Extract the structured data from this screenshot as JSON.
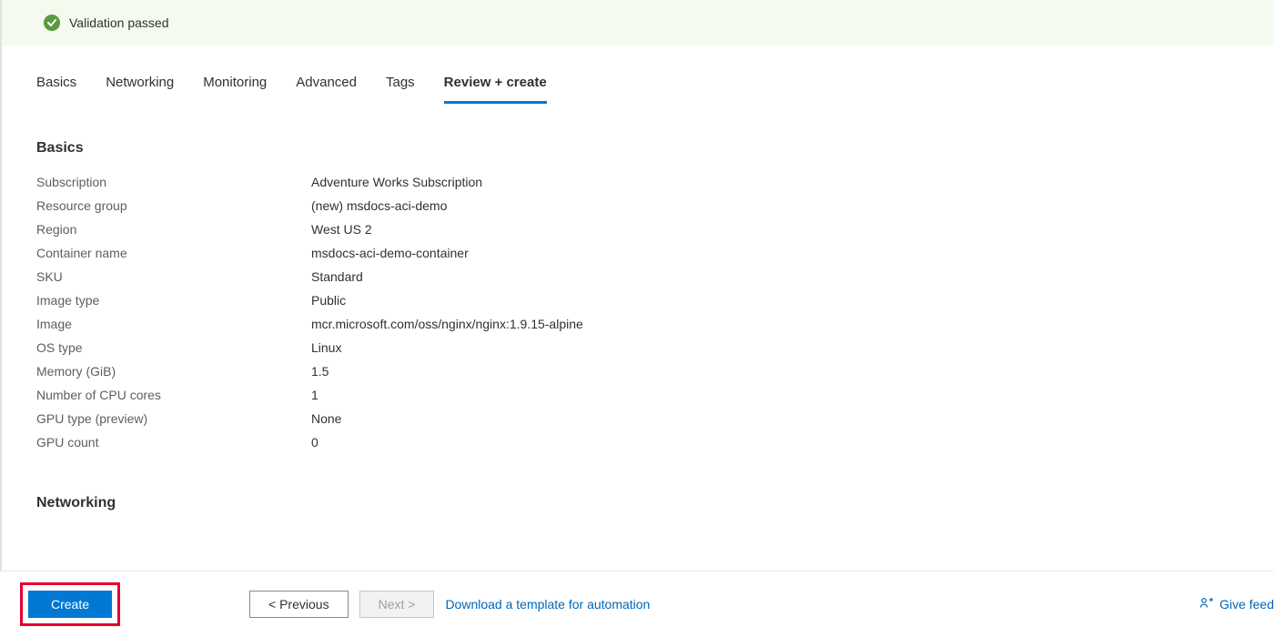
{
  "validation": {
    "message": "Validation passed"
  },
  "tabs": [
    {
      "label": "Basics"
    },
    {
      "label": "Networking"
    },
    {
      "label": "Monitoring"
    },
    {
      "label": "Advanced"
    },
    {
      "label": "Tags"
    },
    {
      "label": "Review + create"
    }
  ],
  "sections": {
    "basics": {
      "title": "Basics",
      "rows": [
        {
          "label": "Subscription",
          "value": "Adventure Works Subscription"
        },
        {
          "label": "Resource group",
          "value": "(new) msdocs-aci-demo"
        },
        {
          "label": "Region",
          "value": "West US 2"
        },
        {
          "label": "Container name",
          "value": "msdocs-aci-demo-container"
        },
        {
          "label": "SKU",
          "value": "Standard"
        },
        {
          "label": "Image type",
          "value": "Public"
        },
        {
          "label": "Image",
          "value": "mcr.microsoft.com/oss/nginx/nginx:1.9.15-alpine"
        },
        {
          "label": "OS type",
          "value": "Linux"
        },
        {
          "label": "Memory (GiB)",
          "value": "1.5"
        },
        {
          "label": "Number of CPU cores",
          "value": "1"
        },
        {
          "label": "GPU type (preview)",
          "value": "None"
        },
        {
          "label": "GPU count",
          "value": "0"
        }
      ]
    },
    "networking": {
      "title": "Networking"
    }
  },
  "footer": {
    "create": "Create",
    "previous": "< Previous",
    "next": "Next >",
    "download": "Download a template for automation",
    "feedback": "Give feed"
  }
}
